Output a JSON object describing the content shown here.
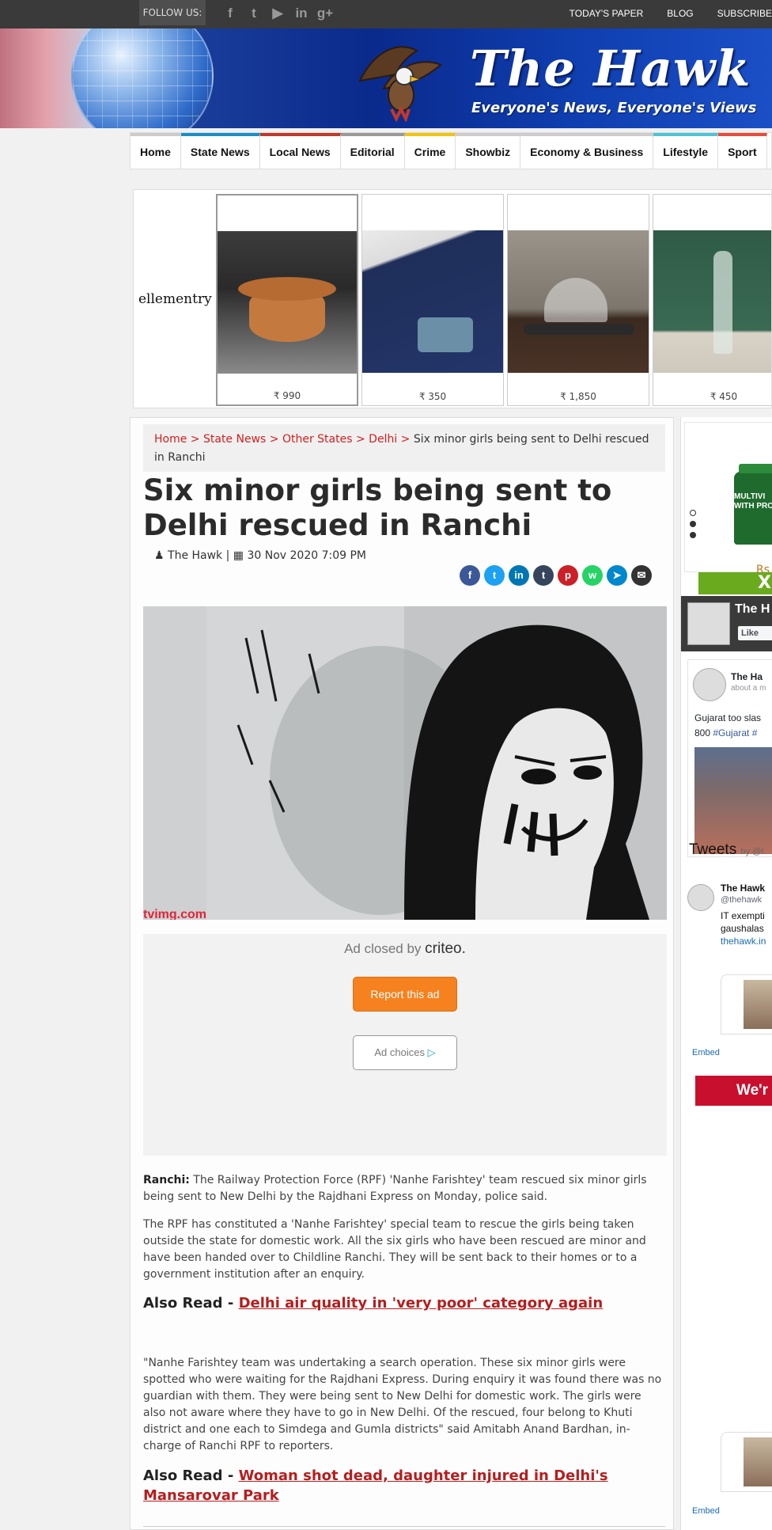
{
  "topbar": {
    "follow_label": "FOLLOW US:",
    "social_icons": [
      "facebook-icon",
      "twitter-icon",
      "youtube-icon",
      "linkedin-icon",
      "google-plus-icon"
    ],
    "links": [
      "TODAY'S PAPER",
      "BLOG",
      "SUBSCRIBE"
    ]
  },
  "banner": {
    "title": "The Hawk",
    "tagline": "Everyone's News, Everyone's Views"
  },
  "nav": {
    "items": [
      {
        "label": "Home",
        "color": "#cccccc"
      },
      {
        "label": "State News",
        "color": "#1a8fc4"
      },
      {
        "label": "Local News",
        "color": "#c0392b"
      },
      {
        "label": "Editorial",
        "color": "#999999"
      },
      {
        "label": "Crime",
        "color": "#f1c40f"
      },
      {
        "label": "Showbiz",
        "color": "#cccccc"
      },
      {
        "label": "Economy & Business",
        "color": "#cccccc"
      },
      {
        "label": "Lifestyle",
        "color": "#4dc4d6"
      },
      {
        "label": "Sport",
        "color": "#e74c3c"
      }
    ]
  },
  "ad_strip": {
    "brand": "ellementry",
    "products": [
      {
        "price": "₹ 990"
      },
      {
        "price": "₹ 350"
      },
      {
        "price": "₹ 1,850"
      },
      {
        "price": "₹ 450"
      }
    ]
  },
  "article": {
    "breadcrumb": {
      "links": [
        "Home",
        "State News",
        "Other States",
        "Delhi"
      ],
      "separator": ">",
      "current": "Six minor girls being sent to Delhi rescued in Ranchi"
    },
    "title": "Six minor girls being sent to Delhi rescued in Ranchi",
    "author": "The Hawk",
    "date": "30 Nov 2020 7:09 PM",
    "share_icons": [
      {
        "name": "facebook-share-icon",
        "glyph": "f",
        "color": "#3b5998"
      },
      {
        "name": "twitter-share-icon",
        "glyph": "t",
        "color": "#1da1f2"
      },
      {
        "name": "linkedin-share-icon",
        "glyph": "in",
        "color": "#0077b5"
      },
      {
        "name": "tumblr-share-icon",
        "glyph": "t",
        "color": "#35465c"
      },
      {
        "name": "pinterest-share-icon",
        "glyph": "p",
        "color": "#cb2027"
      },
      {
        "name": "whatsapp-share-icon",
        "glyph": "w",
        "color": "#25d366"
      },
      {
        "name": "telegram-share-icon",
        "glyph": "➤",
        "color": "#0088cc"
      },
      {
        "name": "email-share-icon",
        "glyph": "✉",
        "color": "#333333"
      }
    ],
    "ad_closed": {
      "prefix": "Ad closed by",
      "brand": "criteo.",
      "report_label": "Report this ad",
      "choices_label": "Ad choices"
    },
    "lead_place": "Ranchi:",
    "paragraph1": " The Railway Protection Force (RPF) 'Nanhe Farishtey' team rescued six minor girls being sent to New Delhi by the Rajdhani Express on Monday, police said.",
    "paragraph2": "The RPF has constituted a 'Nanhe Farishtey' special team to rescue the girls being taken outside the state for domestic work. All the six girls who have been rescued are minor and have been handed over to Childline Ranchi. They will be sent back to their homes or to a government institution after an enquiry.",
    "also_read_label": "Also Read -",
    "also_read_1": "Delhi air quality in 'very poor' category again",
    "paragraph3": "\"Nanhe Farishtey team was undertaking a search operation. These six minor girls were spotted who were waiting for the Rajdhani Express. During enquiry it was found there was no guardian with them. They were being sent to New Delhi for domestic work. The girls were also not aware where they have to go in New Delhi. Of the rescued, four belong to Khuti district and one each to Simdega and Gumla districts\" said Amitabh Anand Bardhan, in-charge of Ranchi RPF to reporters.",
    "also_read_2": "Woman shot dead, daughter injured in Delhi's Mansarovar Park"
  },
  "sidebar": {
    "ad_product_text": "MULTIVI WITH PRO",
    "ad_price": "Rs",
    "ad_close": "X",
    "fb_page_title": "The H",
    "fb_like": "Like",
    "fb_post_name": "The Ha",
    "fb_post_time": "about a m",
    "fb_post_text_1": "Gujarat too slas",
    "fb_post_text_2": "800 ",
    "fb_post_hashtag": "#Gujarat #",
    "tweets_title": "Tweets",
    "tweets_by": "by @t",
    "tweet_name": "The Hawk",
    "tweet_handle": "@thehawk",
    "tweet_text_1": "IT exempti",
    "tweet_text_2": "gaushalas",
    "tweet_link": "thehawk.in",
    "embed_label": "Embed",
    "banner_text": "We'r"
  }
}
